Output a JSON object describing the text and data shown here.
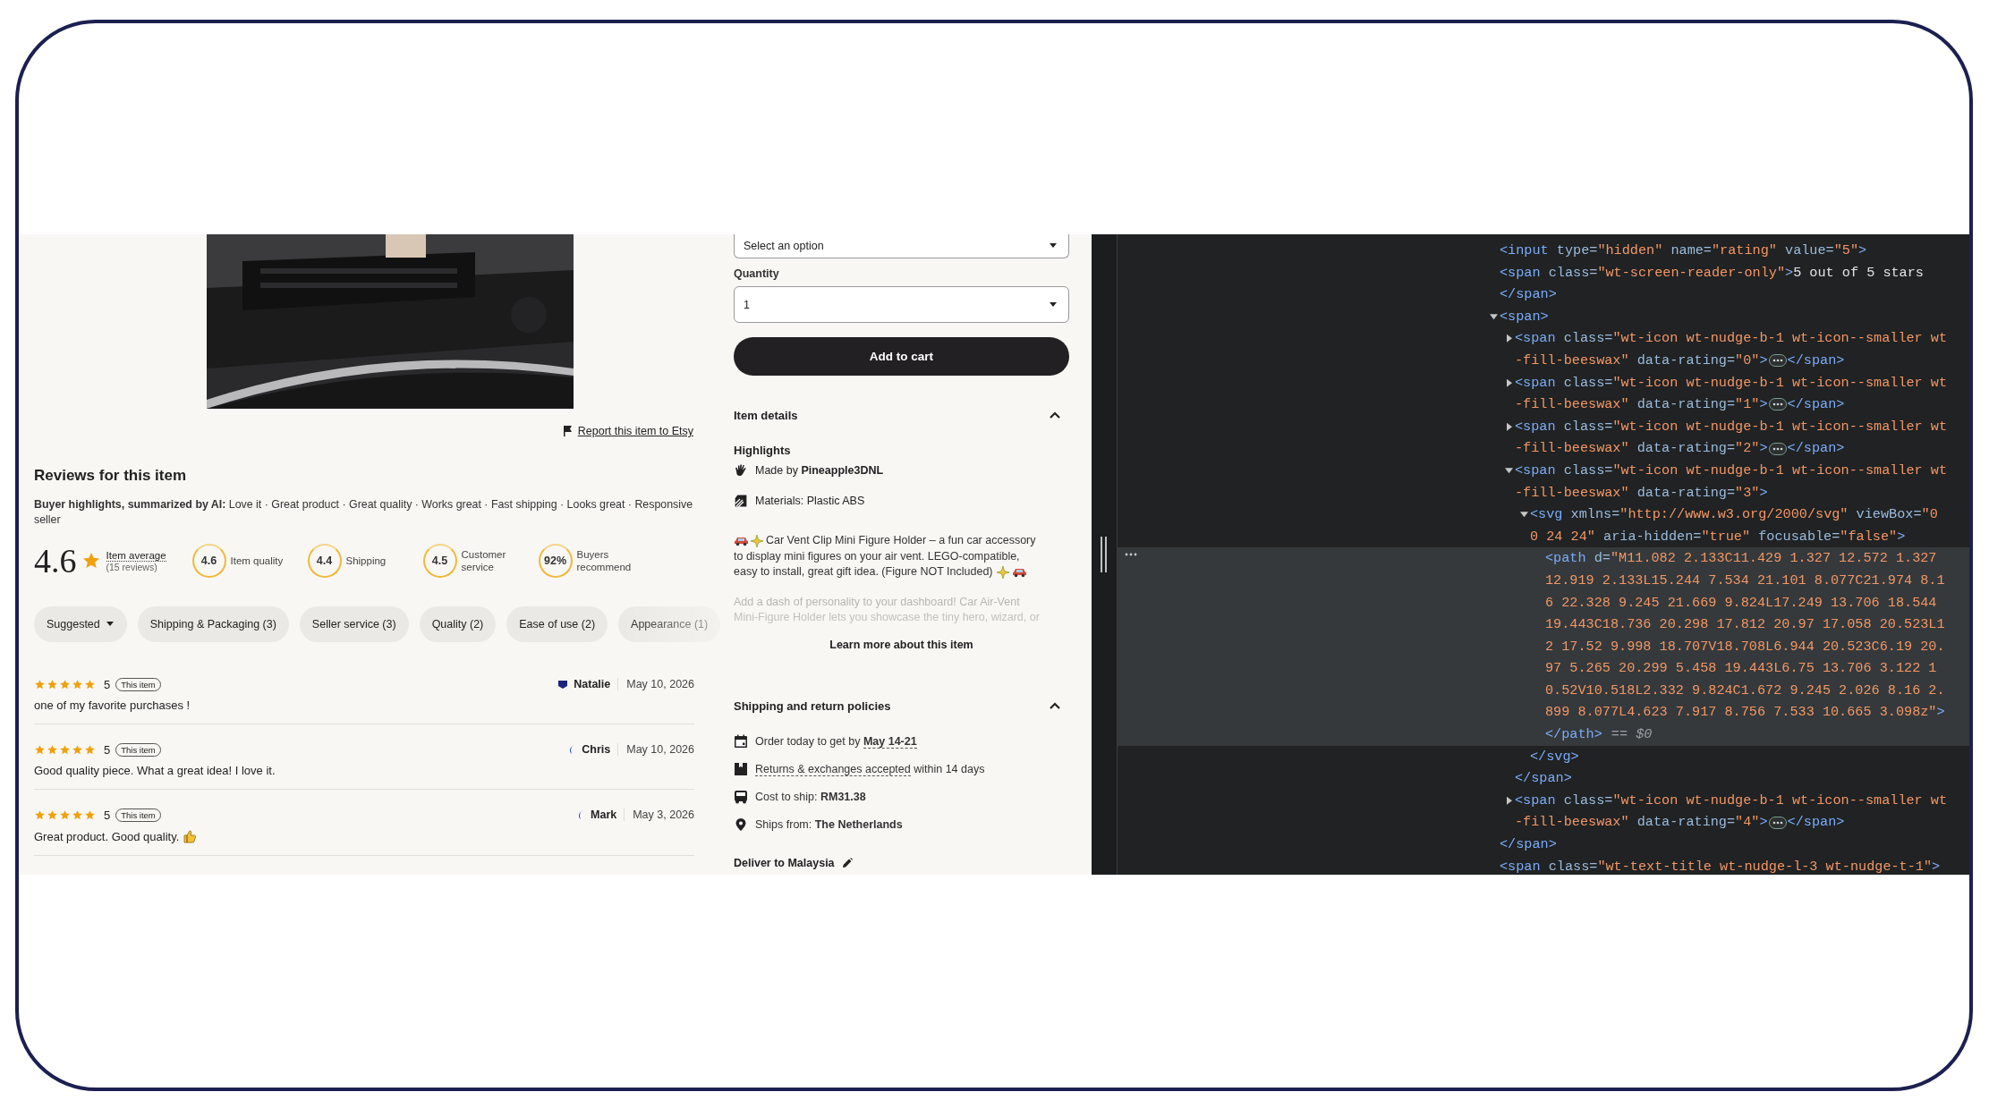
{
  "report_link": "Report this item to Etsy",
  "reviews": {
    "title": "Reviews for this item",
    "highlights": "**Buyer highlights, summarized by AI:** Love it · Great product · Great quality · Works great · Fast shipping · Looks great · Responsive seller",
    "average": {
      "value": "4.6",
      "label": "Item average",
      "count": "(15 reviews)"
    },
    "scores": [
      {
        "value": "4.6",
        "label": "Item quality"
      },
      {
        "value": "4.4",
        "label": "Shipping"
      },
      {
        "value": "4.5",
        "label": "Customer service"
      },
      {
        "value": "92%",
        "label": "Buyers recommend"
      }
    ],
    "filters": [
      {
        "label": "Suggested",
        "kind": "dropdown"
      },
      {
        "label": "Shipping & Packaging (3)",
        "kind": "chip"
      },
      {
        "label": "Seller service (3)",
        "kind": "chip"
      },
      {
        "label": "Quality (2)",
        "kind": "chip"
      },
      {
        "label": "Ease of use (2)",
        "kind": "chip"
      },
      {
        "label": "Appearance (1)",
        "kind": "chip"
      }
    ],
    "list": [
      {
        "stars": 5,
        "rating": "5",
        "badge": "This item",
        "author": "Natalie",
        "date": "May 10, 2026",
        "text": "one of my favorite purchases !"
      },
      {
        "stars": 5,
        "rating": "5",
        "badge": "This item",
        "author": "Chris",
        "date": "May 10, 2026",
        "text": "Good quality piece. What a great idea! I love it."
      },
      {
        "stars": 5,
        "rating": "5",
        "badge": "This item",
        "author": "Mark",
        "date": "May 3, 2026",
        "text": "Great product. Good quality."
      }
    ]
  },
  "purchase": {
    "variant_select": {
      "value": "Select an option"
    },
    "quantity": {
      "label": "Quantity",
      "value": "1"
    },
    "add_to_cart": "Add to cart"
  },
  "item_details": {
    "title": "Item details",
    "expanded": true,
    "highlights_title": "Highlights",
    "highlights": [
      {
        "kind": "maker",
        "text": "Made by **Pineapple3DNL**"
      },
      {
        "kind": "material",
        "text": "Materials: Plastic ABS"
      }
    ],
    "description_lines": [
      "Car Vent Clip Mini Figure Holder – a fun car accessory",
      "to display mini figures on your air vent. LEGO-compatible,",
      "easy to install, great gift idea. (Figure NOT Included)"
    ],
    "faded": [
      "Add a dash of personality to your dashboard! Car Air-Vent",
      "Mini-Figure Holder lets you showcase the tiny hero, wizard, or"
    ],
    "learn_more": "Learn more about this item"
  },
  "shipping": {
    "title": "Shipping and return policies",
    "expanded": true,
    "rows": [
      {
        "kind": "delivery",
        "text": "Order today to get by",
        "highlight": "May 14-21"
      },
      {
        "kind": "returns",
        "highlight": "Returns & exchanges accepted",
        "text": "within 14 days"
      },
      {
        "kind": "cost",
        "text": "Cost to ship:",
        "highlight": "RM31.38"
      },
      {
        "kind": "origin",
        "text": "Ships from:",
        "highlight": "The Netherlands"
      }
    ],
    "deliver_to": "Deliver to Malaysia"
  },
  "devtools": {
    "nodes": [
      {
        "lines": [
          "<input type=\"hidden\" name=\"rating\" value=\"5\">"
        ]
      },
      {
        "lines": [
          "<span class=\"wt-screen-reader-only\">5 out of 5 stars"
        ],
        "close": "</span>"
      },
      {
        "expanded": true,
        "lines": [
          "<span>"
        ],
        "close": "</span>",
        "children": [
          {
            "expanded": false,
            "lines": [
              "<span class=\"wt-icon wt-nudge-b-1 wt-icon--smaller wt",
              "-fill-beeswax\" data-rating=\"0\">"
            ],
            "close": "</span>"
          },
          {
            "expanded": false,
            "lines": [
              "<span class=\"wt-icon wt-nudge-b-1 wt-icon--smaller wt",
              "-fill-beeswax\" data-rating=\"1\">"
            ],
            "close": "</span>"
          },
          {
            "expanded": false,
            "lines": [
              "<span class=\"wt-icon wt-nudge-b-1 wt-icon--smaller wt",
              "-fill-beeswax\" data-rating=\"2\">"
            ],
            "close": "</span>"
          },
          {
            "expanded": true,
            "lines": [
              "<span class=\"wt-icon wt-nudge-b-1 wt-icon--smaller wt",
              "-fill-beeswax\" data-rating=\"3\">"
            ],
            "close": "</span>",
            "children": [
              {
                "expanded": true,
                "lines": [
                  "<svg xmlns=\"http://www.w3.org/2000/svg\" viewBox=\"0",
                  "0 24 24\" aria-hidden=\"true\" focusable=\"false\">"
                ],
                "close": "</svg>",
                "children": [
                  {
                    "selected": true,
                    "console_ref": "== $0",
                    "lines": [
                      "<path d=\"M11.082 2.133C11.429 1.327 12.572 1.327",
                      "12.919 2.133L15.244 7.534 21.101 8.077C21.974 8.1",
                      "6 22.328 9.245 21.669 9.824L17.249 13.706 18.544",
                      "19.443C18.736 20.298 17.812 20.97 17.058 20.523L1",
                      "2 17.52 9.998 18.707V18.708L6.944 20.523C6.19 20.",
                      "97 5.265 20.299 5.458 19.443L6.75 13.706 3.122 1",
                      "0.52V10.518L2.332 9.824C1.672 9.245 2.026 8.16 2.",
                      "899 8.077L4.623 7.917 8.756 7.533 10.665 3.098z\">"
                    ],
                    "close": "</path>"
                  }
                ]
              }
            ]
          },
          {
            "expanded": false,
            "lines": [
              "<span class=\"wt-icon wt-nudge-b-1 wt-icon--smaller wt",
              "-fill-beeswax\" data-rating=\"4\">"
            ],
            "close": "</span>"
          }
        ]
      },
      {
        "lines": [
          "<span class=\"wt-text-title wt-nudge-l-3 wt-nudge-t-1\">"
        ]
      }
    ]
  }
}
